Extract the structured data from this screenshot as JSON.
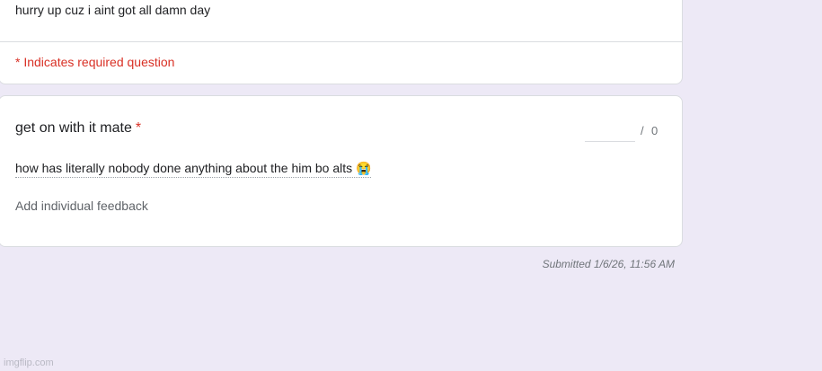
{
  "header": {
    "description": "hurry up cuz i aint got all damn day",
    "required_note": "* Indicates required question"
  },
  "question": {
    "title": "get on with it mate",
    "required_mark": "*",
    "score_value": "",
    "score_slash": "/",
    "score_max": "0",
    "answer": "how has literally nobody done anything about the him bo alts 😭",
    "feedback_link": "Add individual feedback"
  },
  "footer": {
    "submitted": "Submitted 1/6/26, 11:56 AM"
  },
  "watermark": "imgflip.com",
  "colors": {
    "page_background": "#ede9f6",
    "card_background": "#ffffff",
    "required_red": "#d93025",
    "border": "#dadce0"
  }
}
